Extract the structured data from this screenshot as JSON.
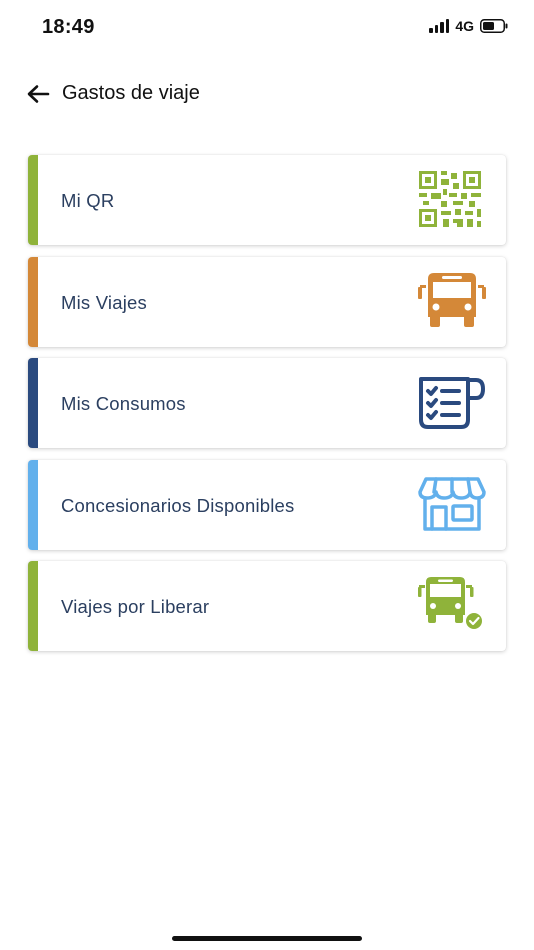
{
  "status_bar": {
    "time": "18:49",
    "network": "4G"
  },
  "header": {
    "title": "Gastos de viaje"
  },
  "menu": [
    {
      "label": "Mi QR",
      "icon": "qr-code-icon",
      "accent": "#8fb33a"
    },
    {
      "label": "Mis Viajes",
      "icon": "bus-icon",
      "accent": "#d48838"
    },
    {
      "label": "Mis Consumos",
      "icon": "checklist-cup-icon",
      "accent": "#2a4a7f"
    },
    {
      "label": "Concesionarios Disponibles",
      "icon": "store-icon",
      "accent": "#62b0ec"
    },
    {
      "label": "Viajes por Liberar",
      "icon": "bus-check-icon",
      "accent": "#8fb33a"
    }
  ]
}
